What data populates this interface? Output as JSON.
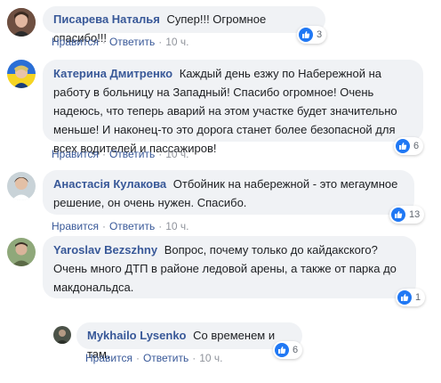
{
  "comments": [
    {
      "author": "Писарева Наталья",
      "text": "Супер!!! Огромное спасибо!!!",
      "like": "Нравится",
      "reply": "Ответить",
      "time": "10 ч.",
      "reaction_count": "3"
    },
    {
      "author": "Катерина Дмитренко",
      "text": "Каждый день езжу по Набережной на работу в больницу на Западный! Спасибо огромное! Очень надеюсь, что теперь аварий на этом участке будет значительно меньше! И наконец-то это дорога станет более безопасной для всех водителей и пассажиров!",
      "like": "Нравится",
      "reply": "Ответить",
      "time": "10 ч.",
      "reaction_count": "6"
    },
    {
      "author": "Анастасія Кулакова",
      "text": "Отбойник на набережной - это мегаумное решение, он очень нужен. Спасибо.",
      "like": "Нравится",
      "reply": "Ответить",
      "time": "10 ч.",
      "reaction_count": "13"
    },
    {
      "author": "Yaroslav Bezszhny",
      "text": "Вопрос, почему только до кайдакского? Очень много ДТП в районе ледовой арены, а также от парка до макдональдса.",
      "like": "Нравится",
      "reply": "Ответить",
      "time": "10 ч.",
      "reaction_count": "1"
    }
  ],
  "reply": {
    "author": "Mykhailo Lysenko",
    "text": "Со временем и там.",
    "like": "Нравится",
    "reply": "Ответить",
    "time": "10 ч.",
    "reaction_count": "6"
  },
  "colors": {
    "author": "#385898",
    "bubble": "#f0f2f5",
    "like_badge": "#2078f4",
    "meta": "#90949c"
  },
  "icons": [
    "like-icon"
  ]
}
